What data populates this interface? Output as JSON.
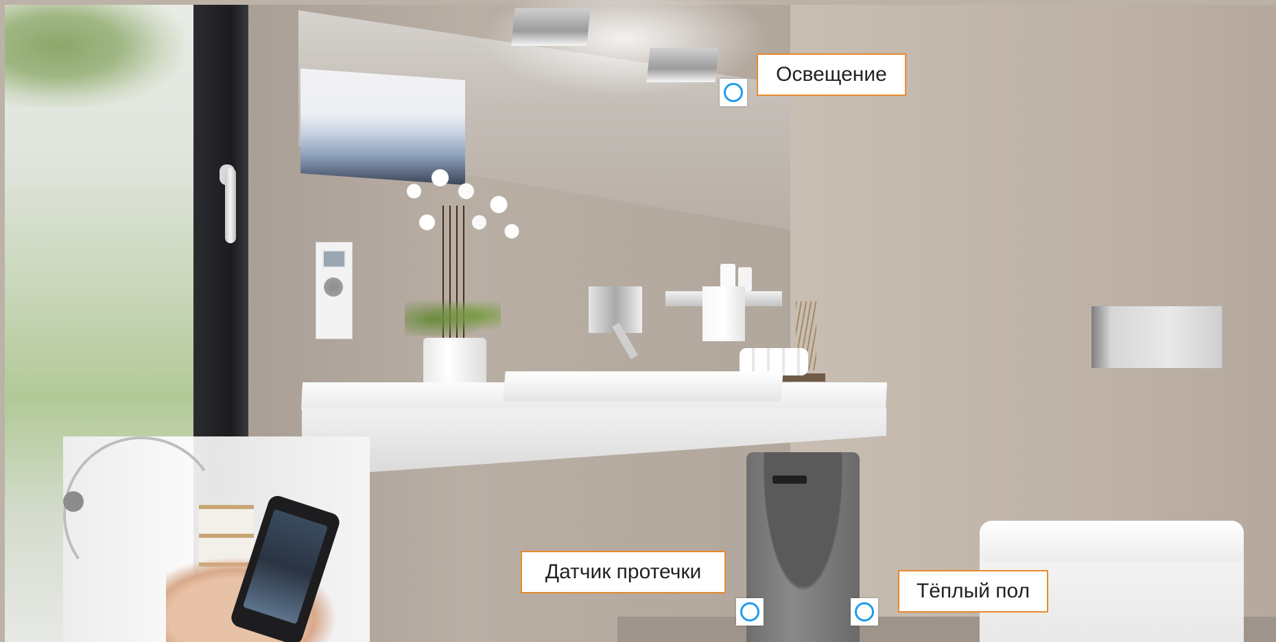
{
  "hotspots": [
    {
      "id": "lighting",
      "label": "Освещение"
    },
    {
      "id": "leak-sensor",
      "label": "Датчик протечки"
    },
    {
      "id": "heated-floor",
      "label": "Тёплый пол"
    }
  ],
  "colors": {
    "hotspot_accent": "#1e9cea",
    "label_border": "#e8892b",
    "label_text": "#222222"
  },
  "icons": {
    "hotspot": "target-circle-icon"
  }
}
